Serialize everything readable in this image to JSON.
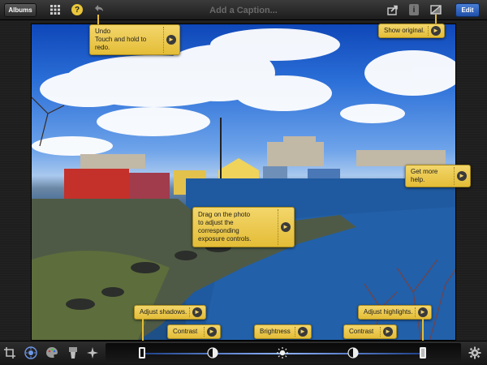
{
  "toolbar": {
    "albums_label": "Albums",
    "help_glyph": "?",
    "caption_placeholder": "Add a Caption...",
    "info_glyph": "i",
    "edit_label": "Edit"
  },
  "tips": {
    "undo_line1": "Undo",
    "undo_line2": "Touch and hold to redo.",
    "show_original": "Show original.",
    "more_help": "Get more help.",
    "drag_line1": "Drag on the photo",
    "drag_line2": "to adjust the corresponding",
    "drag_line3": "exposure controls.",
    "shadows": "Adjust shadows.",
    "contrast_left": "Contrast",
    "brightness": "Brightness",
    "contrast_right": "Contrast",
    "highlights": "Adjust highlights."
  },
  "icons": {
    "grid": "grid-icon",
    "help": "help-icon",
    "undo": "undo-icon",
    "share": "share-icon",
    "info": "info-icon",
    "original": "show-original-icon",
    "crop": "crop-icon",
    "exposure": "exposure-icon",
    "color": "color-palette-icon",
    "brushes": "brushes-icon",
    "effects": "effects-icon",
    "gear": "gear-icon"
  },
  "colors": {
    "tip": "#e9c63a",
    "edit_button": "#2f62c0",
    "accent": "#6f97e8"
  }
}
